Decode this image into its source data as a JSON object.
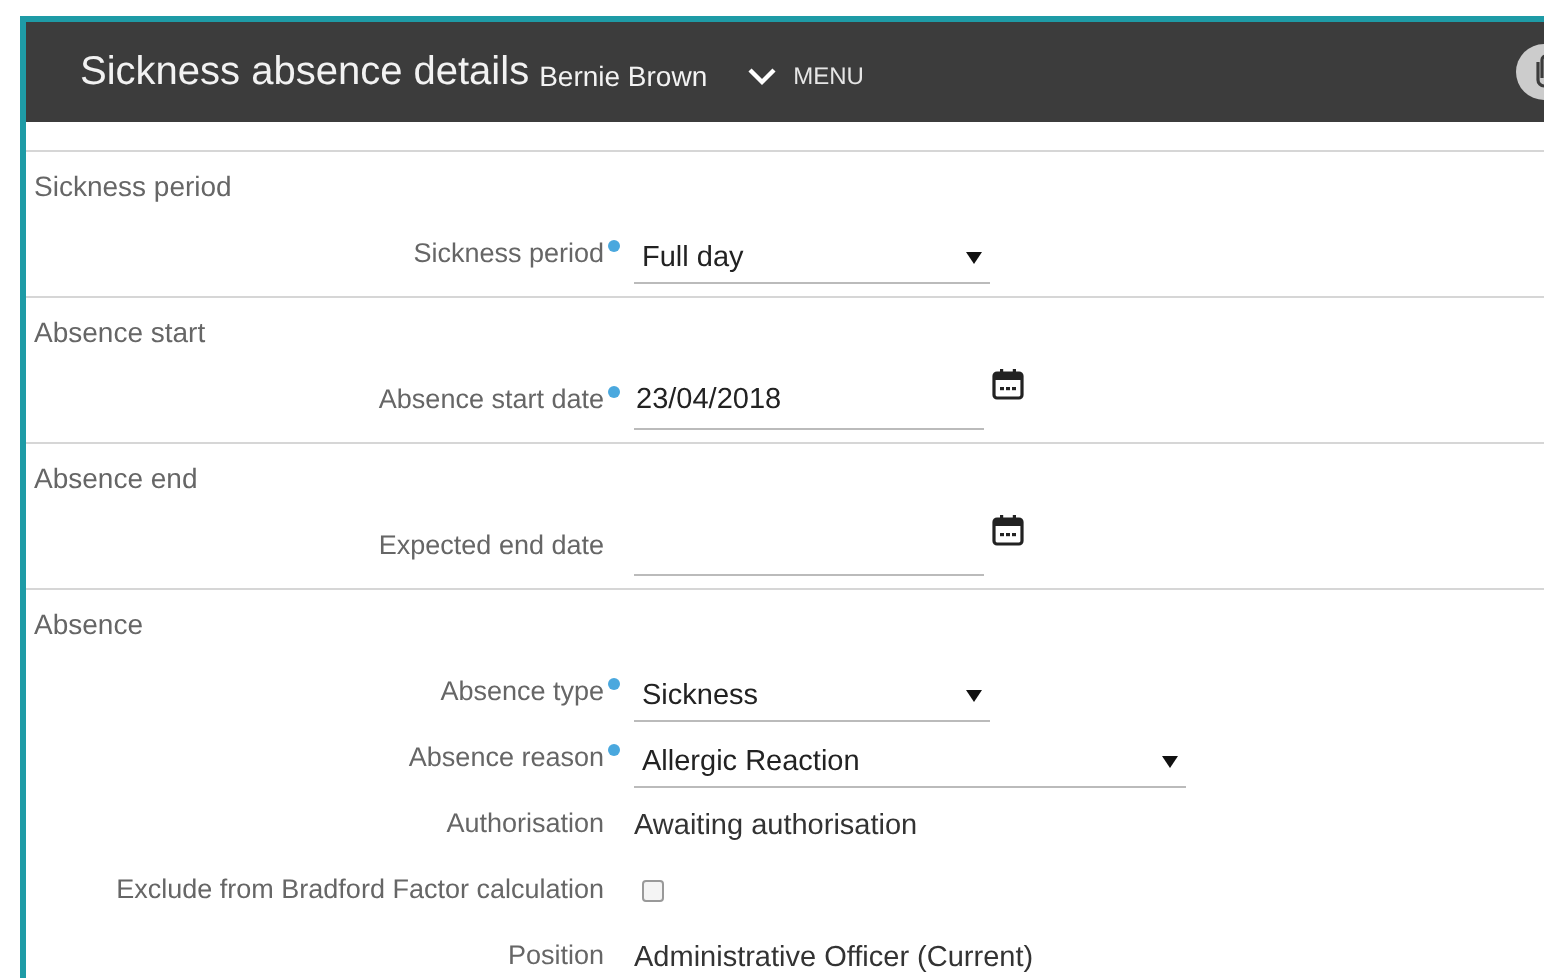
{
  "header": {
    "title": "Sickness absence details",
    "subtitle": "Bernie Brown",
    "menu_label": "MENU"
  },
  "sections": [
    {
      "title": "Sickness period",
      "fields": [
        {
          "kind": "select",
          "label": "Sickness period",
          "required": true,
          "value": "Full day"
        }
      ]
    },
    {
      "title": "Absence start",
      "fields": [
        {
          "kind": "date",
          "label": "Absence start date",
          "required": true,
          "value": "23/04/2018"
        }
      ]
    },
    {
      "title": "Absence end",
      "fields": [
        {
          "kind": "date",
          "label": "Expected end date",
          "required": false
        }
      ]
    },
    {
      "title": "Absence",
      "fields": [
        {
          "kind": "select",
          "label": "Absence type",
          "required": true,
          "value": "Sickness"
        },
        {
          "kind": "select",
          "label": "Absence reason",
          "required": true,
          "value": "Allergic Reaction"
        },
        {
          "kind": "text",
          "label": "Authorisation",
          "required": false,
          "value": "Awaiting authorisation"
        },
        {
          "kind": "checkbox",
          "label": "Exclude from Bradford Factor calculation",
          "required": false,
          "checked": false
        },
        {
          "kind": "text",
          "label": "Position",
          "required": false,
          "value": "Administrative Officer (Current)"
        }
      ]
    }
  ]
}
